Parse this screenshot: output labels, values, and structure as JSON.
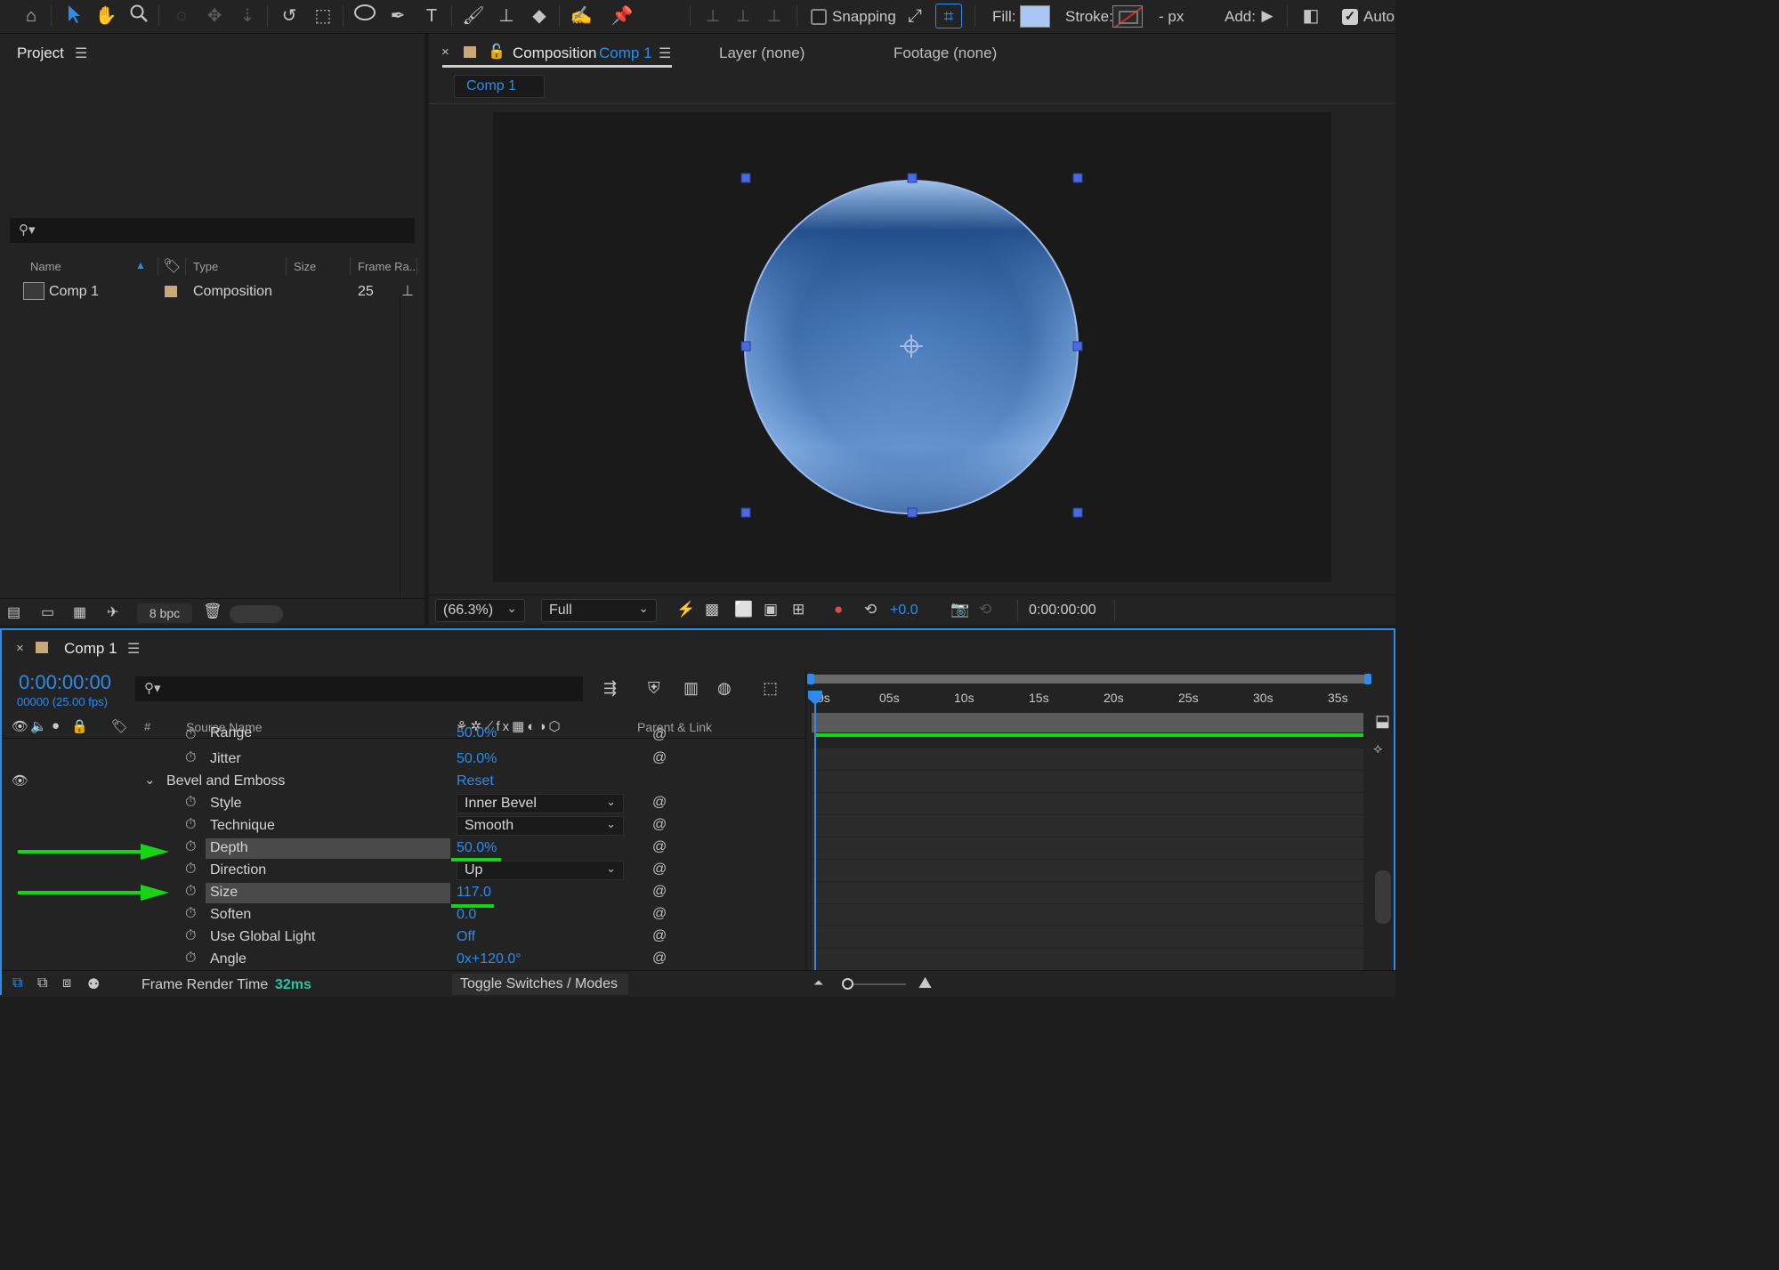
{
  "toolbar": {
    "snapping_label": "Snapping",
    "fill_label": "Fill:",
    "stroke_label": "Stroke:",
    "stroke_px": "- px",
    "add_label": "Add:",
    "auto_label": "Auto",
    "fill_color": "#a9c6f5",
    "accent": "#2d8ceb"
  },
  "project": {
    "title": "Project",
    "columns": [
      "Name",
      "Type",
      "Size",
      "Frame Ra..."
    ],
    "rows": [
      {
        "name": "Comp 1",
        "type": "Composition",
        "frame_rate": "25"
      }
    ],
    "bpc": "8 bpc"
  },
  "composition": {
    "tab_prefix": "Composition",
    "tab_comp": "Comp 1",
    "layer_tab": "Layer (none)",
    "footage_tab": "Footage (none)",
    "breadcrumb": "Comp 1",
    "zoom": "(66.3%)",
    "resolution": "Full",
    "exposure": "+0.0",
    "timecode": "0:00:00:00"
  },
  "timeline": {
    "tab_label": "Comp 1",
    "current_time": "0:00:00:00",
    "frame_info": "00000 (25.00 fps)",
    "col_source_name": "Source Name",
    "col_parent": "Parent & Link",
    "col_hash": "#",
    "ruler": [
      "0s",
      "05s",
      "10s",
      "15s",
      "20s",
      "25s",
      "30s",
      "35s"
    ],
    "rows": [
      {
        "name": "Range",
        "value": "50.0%"
      },
      {
        "name": "Jitter",
        "value": "50.0%"
      },
      {
        "name": "Bevel and Emboss",
        "value": "Reset"
      },
      {
        "name": "Style",
        "value": "Inner Bevel"
      },
      {
        "name": "Technique",
        "value": "Smooth"
      },
      {
        "name": "Depth",
        "value": "50.0%"
      },
      {
        "name": "Direction",
        "value": "Up"
      },
      {
        "name": "Size",
        "value": "117.0"
      },
      {
        "name": "Soften",
        "value": "0.0"
      },
      {
        "name": "Use Global Light",
        "value": "Off"
      },
      {
        "name": "Angle",
        "value": "0x+120.0°"
      }
    ],
    "frame_render_label": "Frame Render Time",
    "frame_render_value": "32ms",
    "toggle_label": "Toggle Switches / Modes"
  }
}
